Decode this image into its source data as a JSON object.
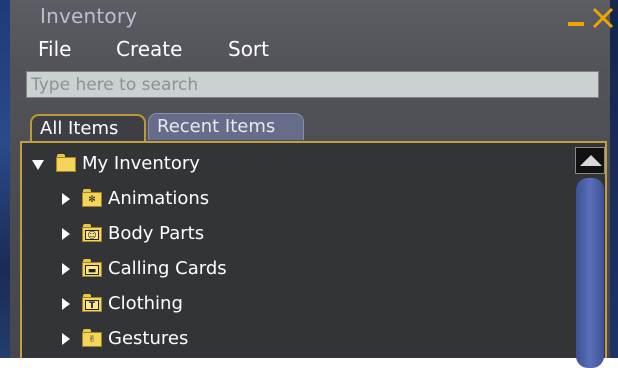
{
  "window": {
    "title": "Inventory"
  },
  "menu": {
    "file": "File",
    "create": "Create",
    "sort": "Sort"
  },
  "search": {
    "placeholder": "Type here to search",
    "value": ""
  },
  "tabs": [
    {
      "label": "All Items",
      "selected": true
    },
    {
      "label": "Recent Items",
      "selected": false
    }
  ],
  "tree": {
    "root": {
      "label": "My Inventory",
      "expanded": true,
      "icon": "folder-open-icon"
    },
    "children": [
      {
        "label": "Animations",
        "expanded": false,
        "icon": "animation-folder-icon"
      },
      {
        "label": "Body Parts",
        "expanded": false,
        "icon": "body-parts-folder-icon"
      },
      {
        "label": "Calling Cards",
        "expanded": false,
        "icon": "calling-card-folder-icon"
      },
      {
        "label": "Clothing",
        "expanded": false,
        "icon": "clothing-folder-icon"
      },
      {
        "label": "Gestures",
        "expanded": false,
        "icon": "gesture-folder-icon"
      }
    ]
  },
  "colors": {
    "panel_bg": "#4e4f54",
    "accent_orange": "#f0a400",
    "tab_border_gold": "#c49e3f",
    "scroll_thumb": "#4f63aa",
    "search_bg": "#cbd1d1",
    "folder_yellow": "#f4d45a"
  },
  "scrollbar": {
    "position_fraction": 0.0
  }
}
